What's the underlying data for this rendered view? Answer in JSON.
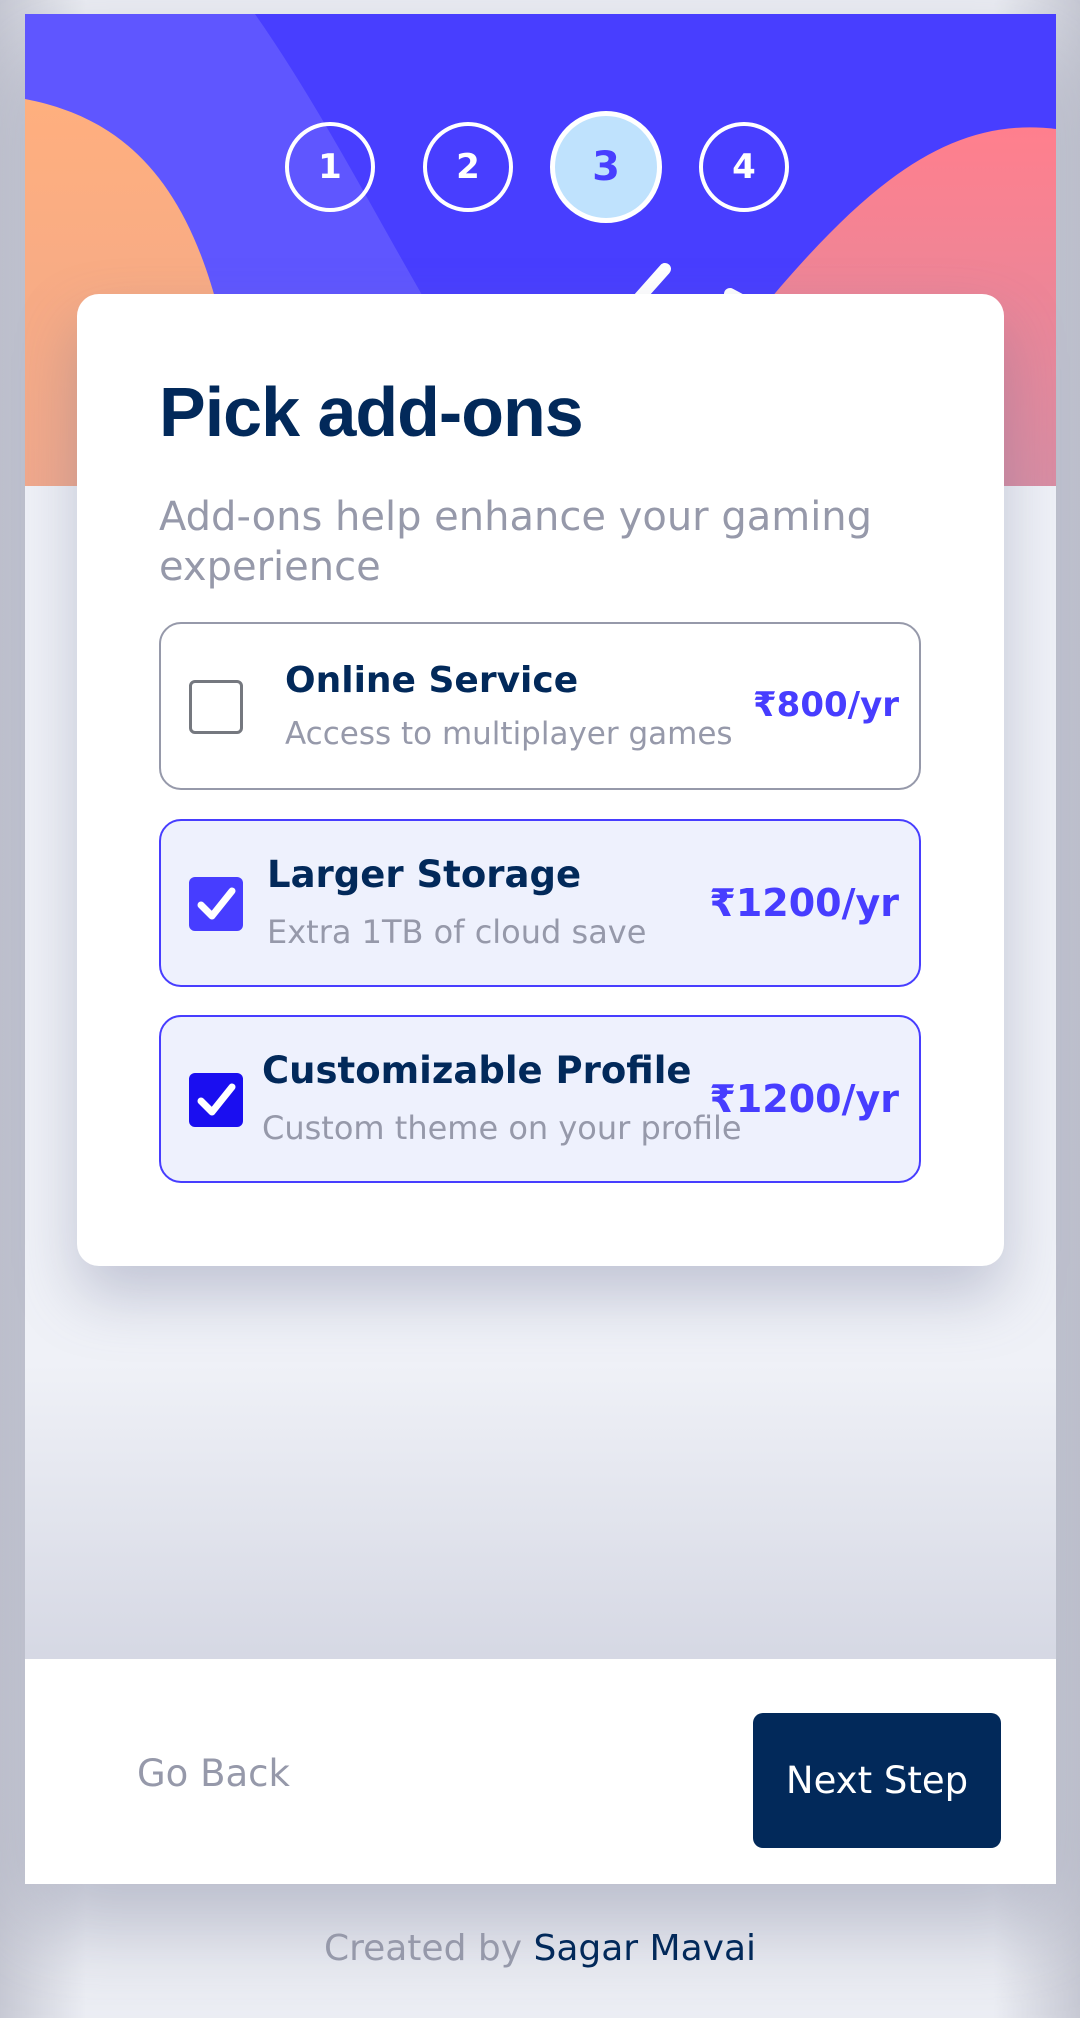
{
  "steps": [
    {
      "number": "1",
      "active": false
    },
    {
      "number": "2",
      "active": false
    },
    {
      "number": "3",
      "active": true
    },
    {
      "number": "4",
      "active": false
    }
  ],
  "card": {
    "title": "Pick add-ons",
    "subtitle": "Add-ons help enhance your gaming experience"
  },
  "addons": [
    {
      "name": "Online Service",
      "description": "Access to multiplayer games",
      "price": "₹800/yr",
      "selected": false
    },
    {
      "name": "Larger Storage",
      "description": "Extra 1TB of cloud save",
      "price": "₹1200/yr",
      "selected": true
    },
    {
      "name": "Customizable Profile",
      "description": "Custom theme on your profile",
      "price": "₹1200/yr",
      "selected": true
    }
  ],
  "footer": {
    "back_label": "Go Back",
    "next_label": "Next Step"
  },
  "credit": {
    "prefix": "Created by",
    "author": "Sagar Mavai"
  },
  "colors": {
    "header_background": "#483eff",
    "accent": "#473dff",
    "denim": "#02295a",
    "active_step": "#bfe2fd",
    "muted_text": "#9699aa",
    "selected_background": "#eef1fd",
    "orange_blob": "#ffaf7e",
    "pink_blob": "#f9818e"
  },
  "icons": {
    "checkbox_checked": "checkmark-icon"
  }
}
